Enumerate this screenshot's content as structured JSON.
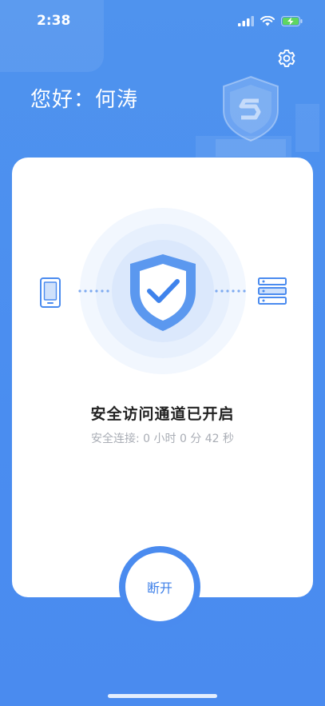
{
  "status_bar": {
    "time": "2:38"
  },
  "header": {
    "greeting": "您好：何涛"
  },
  "connection": {
    "title": "安全访问通道已开启",
    "duration": "安全连接: 0 小时 0 分 42 秒"
  },
  "actions": {
    "disconnect_label": "断开"
  },
  "colors": {
    "accent": "#4a8bef",
    "text_primary": "#222222",
    "text_muted": "#a9adb5"
  },
  "icons": [
    "settings-gear",
    "phone",
    "shield-check",
    "server",
    "shield-s-logo"
  ]
}
